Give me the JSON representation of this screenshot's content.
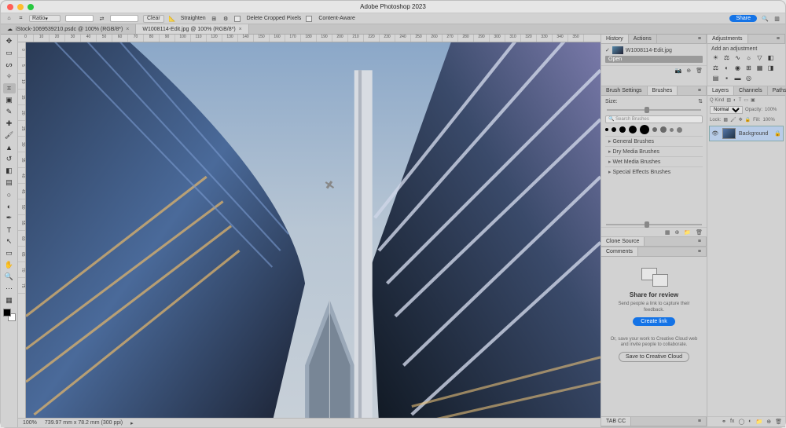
{
  "app": {
    "title": "Adobe Photoshop 2023"
  },
  "topbar": {
    "home_tip": "Home",
    "ratio": "Ratio",
    "w": "",
    "h": "",
    "clear": "Clear",
    "straighten": "Straighten",
    "delete_cropped": "Delete Cropped Pixels",
    "content_aware": "Content-Aware",
    "share": "Share"
  },
  "doctabs": [
    {
      "label": "iStock-1069539210.psdc @ 100% (RGB/8*)",
      "active": false
    },
    {
      "label": "W1008114-Edit.jpg @ 100% (RGB/8*)",
      "active": true
    }
  ],
  "tools": [
    {
      "name": "move-tool",
      "glyph": "✥"
    },
    {
      "name": "marquee-tool",
      "glyph": "▭"
    },
    {
      "name": "lasso-tool",
      "glyph": "ᔕ"
    },
    {
      "name": "magic-wand-tool",
      "glyph": "✧"
    },
    {
      "name": "crop-tool",
      "glyph": "⌗",
      "sel": true
    },
    {
      "name": "frame-tool",
      "glyph": "▣"
    },
    {
      "name": "eyedropper-tool",
      "glyph": "✎"
    },
    {
      "name": "healing-brush-tool",
      "glyph": "✚"
    },
    {
      "name": "brush-tool",
      "glyph": "🖌"
    },
    {
      "name": "clone-stamp-tool",
      "glyph": "▲"
    },
    {
      "name": "history-brush-tool",
      "glyph": "↺"
    },
    {
      "name": "eraser-tool",
      "glyph": "◧"
    },
    {
      "name": "gradient-tool",
      "glyph": "▤"
    },
    {
      "name": "blur-tool",
      "glyph": "○"
    },
    {
      "name": "dodge-tool",
      "glyph": "◐"
    },
    {
      "name": "pen-tool",
      "glyph": "✒"
    },
    {
      "name": "type-tool",
      "glyph": "T"
    },
    {
      "name": "path-tool",
      "glyph": "↖"
    },
    {
      "name": "shape-tool",
      "glyph": "▭"
    },
    {
      "name": "hand-tool",
      "glyph": "✋"
    },
    {
      "name": "zoom-tool",
      "glyph": "🔍"
    },
    {
      "name": "more-tool",
      "glyph": "⋯"
    },
    {
      "name": "edit-toolbar",
      "glyph": "▦"
    }
  ],
  "status": {
    "zoom": "100%",
    "dims": "739.97 mm x 78.2 mm (300 ppi)"
  },
  "panels": {
    "history": {
      "tabs": [
        "History",
        "Actions"
      ],
      "filename": "W1008114-Edit.jpg",
      "steps": [
        "Open"
      ]
    },
    "brushes": {
      "tabs": [
        "Brush Settings",
        "Brushes"
      ],
      "size_label": "Size:",
      "search_placeholder": "Search Brushes",
      "categories": [
        "General Brushes",
        "Dry Media Brushes",
        "Wet Media Brushes",
        "Special Effects Brushes"
      ]
    },
    "clone": {
      "tab": "Clone Source"
    },
    "comments": {
      "tab": "Comments",
      "heading": "Share for review",
      "sub": "Send people a link to capture their feedback.",
      "create": "Create link",
      "or": "Or, save your work to Creative Cloud web and invite people to collaborate.",
      "save_cc": "Save to Creative Cloud"
    },
    "tab_cc": {
      "tab": "TAB CC"
    },
    "adjustments": {
      "tab": "Adjustments",
      "add": "Add an adjustment"
    },
    "layers": {
      "tabs": [
        "Layers",
        "Channels",
        "Paths"
      ],
      "kind": "Q Kind",
      "blend": "Normal",
      "opacity_label": "Opacity:",
      "opacity": "100%",
      "lock": "Lock:",
      "fill_label": "Fill:",
      "fill": "100%",
      "layer_name": "Background"
    }
  },
  "ruler_h": [
    "0",
    "10",
    "20",
    "30",
    "40",
    "50",
    "60",
    "70",
    "80",
    "90",
    "100",
    "110",
    "120",
    "130",
    "140",
    "150",
    "160",
    "170",
    "180",
    "190",
    "200",
    "210",
    "220",
    "230",
    "240",
    "250",
    "260",
    "270",
    "280",
    "290",
    "300",
    "310",
    "320",
    "330",
    "340",
    "350"
  ],
  "ruler_v": [
    "0",
    "5",
    "10",
    "15",
    "20",
    "25",
    "30",
    "35",
    "40",
    "45",
    "50",
    "55",
    "60",
    "65",
    "70",
    "75"
  ]
}
